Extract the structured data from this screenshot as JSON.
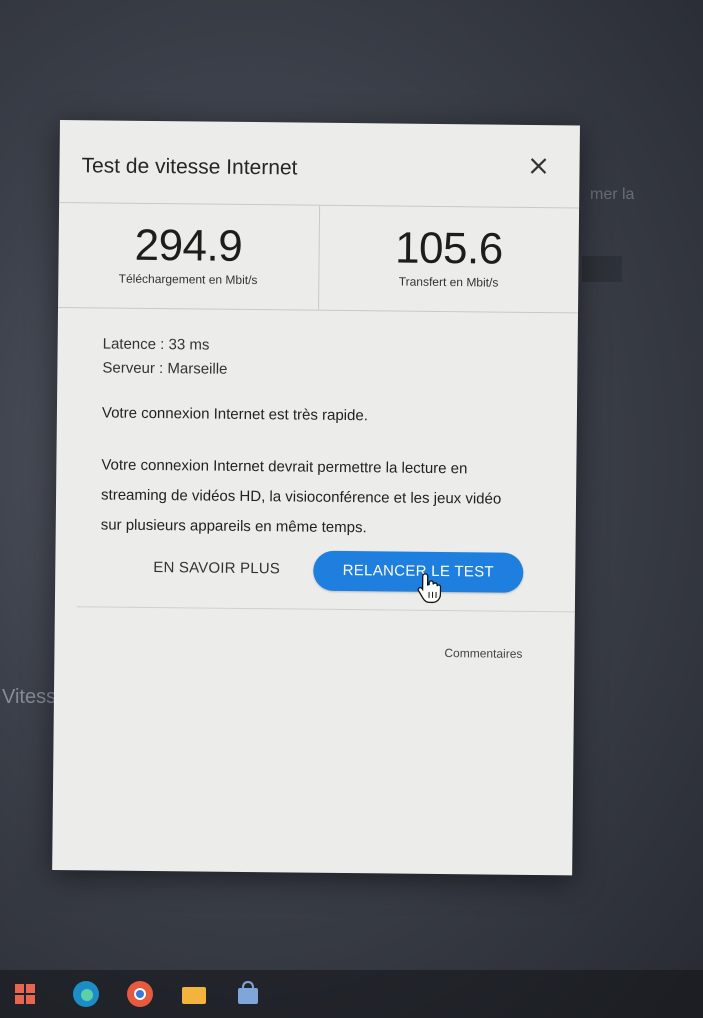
{
  "dialog": {
    "title": "Test de vitesse Internet",
    "download": {
      "value": "294.9",
      "label": "Téléchargement en Mbit/s"
    },
    "upload": {
      "value": "105.6",
      "label": "Transfert en Mbit/s"
    },
    "latency": "Latence : 33 ms",
    "server": "Serveur : Marseille",
    "message_fast": "Votre connexion Internet est très rapide.",
    "message_details": "Votre connexion Internet devrait permettre la lecture en streaming de vidéos HD, la visioconférence et les jeux vidéo sur plusieurs appareils en même temps.",
    "learn_more_label": "EN SAVOIR PLUS",
    "retest_label": "RELANCER LE TEST",
    "feedback_label": "Commentaires"
  },
  "background": {
    "heading": "Vitesse d",
    "right_text": "mer la"
  },
  "colors": {
    "accent": "#1e7fde",
    "dialog_bg": "#ececeb",
    "text": "#222222"
  },
  "taskbar_icons": [
    "windows-icon",
    "edge-icon",
    "chrome-icon",
    "file-explorer-icon",
    "store-icon"
  ]
}
